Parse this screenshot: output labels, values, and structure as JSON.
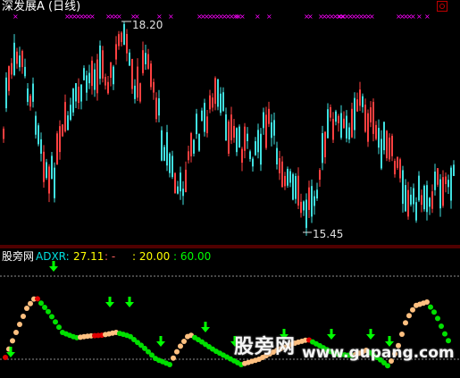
{
  "window": {
    "title": "深发展A (日线)",
    "settings_icon": "gear-icon"
  },
  "main_chart": {
    "high_label": "18.20",
    "low_label": "15.45",
    "high_value": 18.2,
    "low_value": 15.45,
    "colors": {
      "up": "#ff4040",
      "down": "#40e0e0",
      "signal": "#ff00ff"
    }
  },
  "indicator_panel": {
    "source_label": "股旁网",
    "name": "ADXR:",
    "value": "27.11",
    "separator": ":  -",
    "level_low": ": 20.00",
    "level_high": ": 60.00",
    "colors": {
      "rising": "#ffc080",
      "falling": "#00e000",
      "mid": "#e00000",
      "arrow": "#00ff00"
    }
  },
  "watermark": {
    "text": "股旁网",
    "url": "www.gupang.com"
  }
}
